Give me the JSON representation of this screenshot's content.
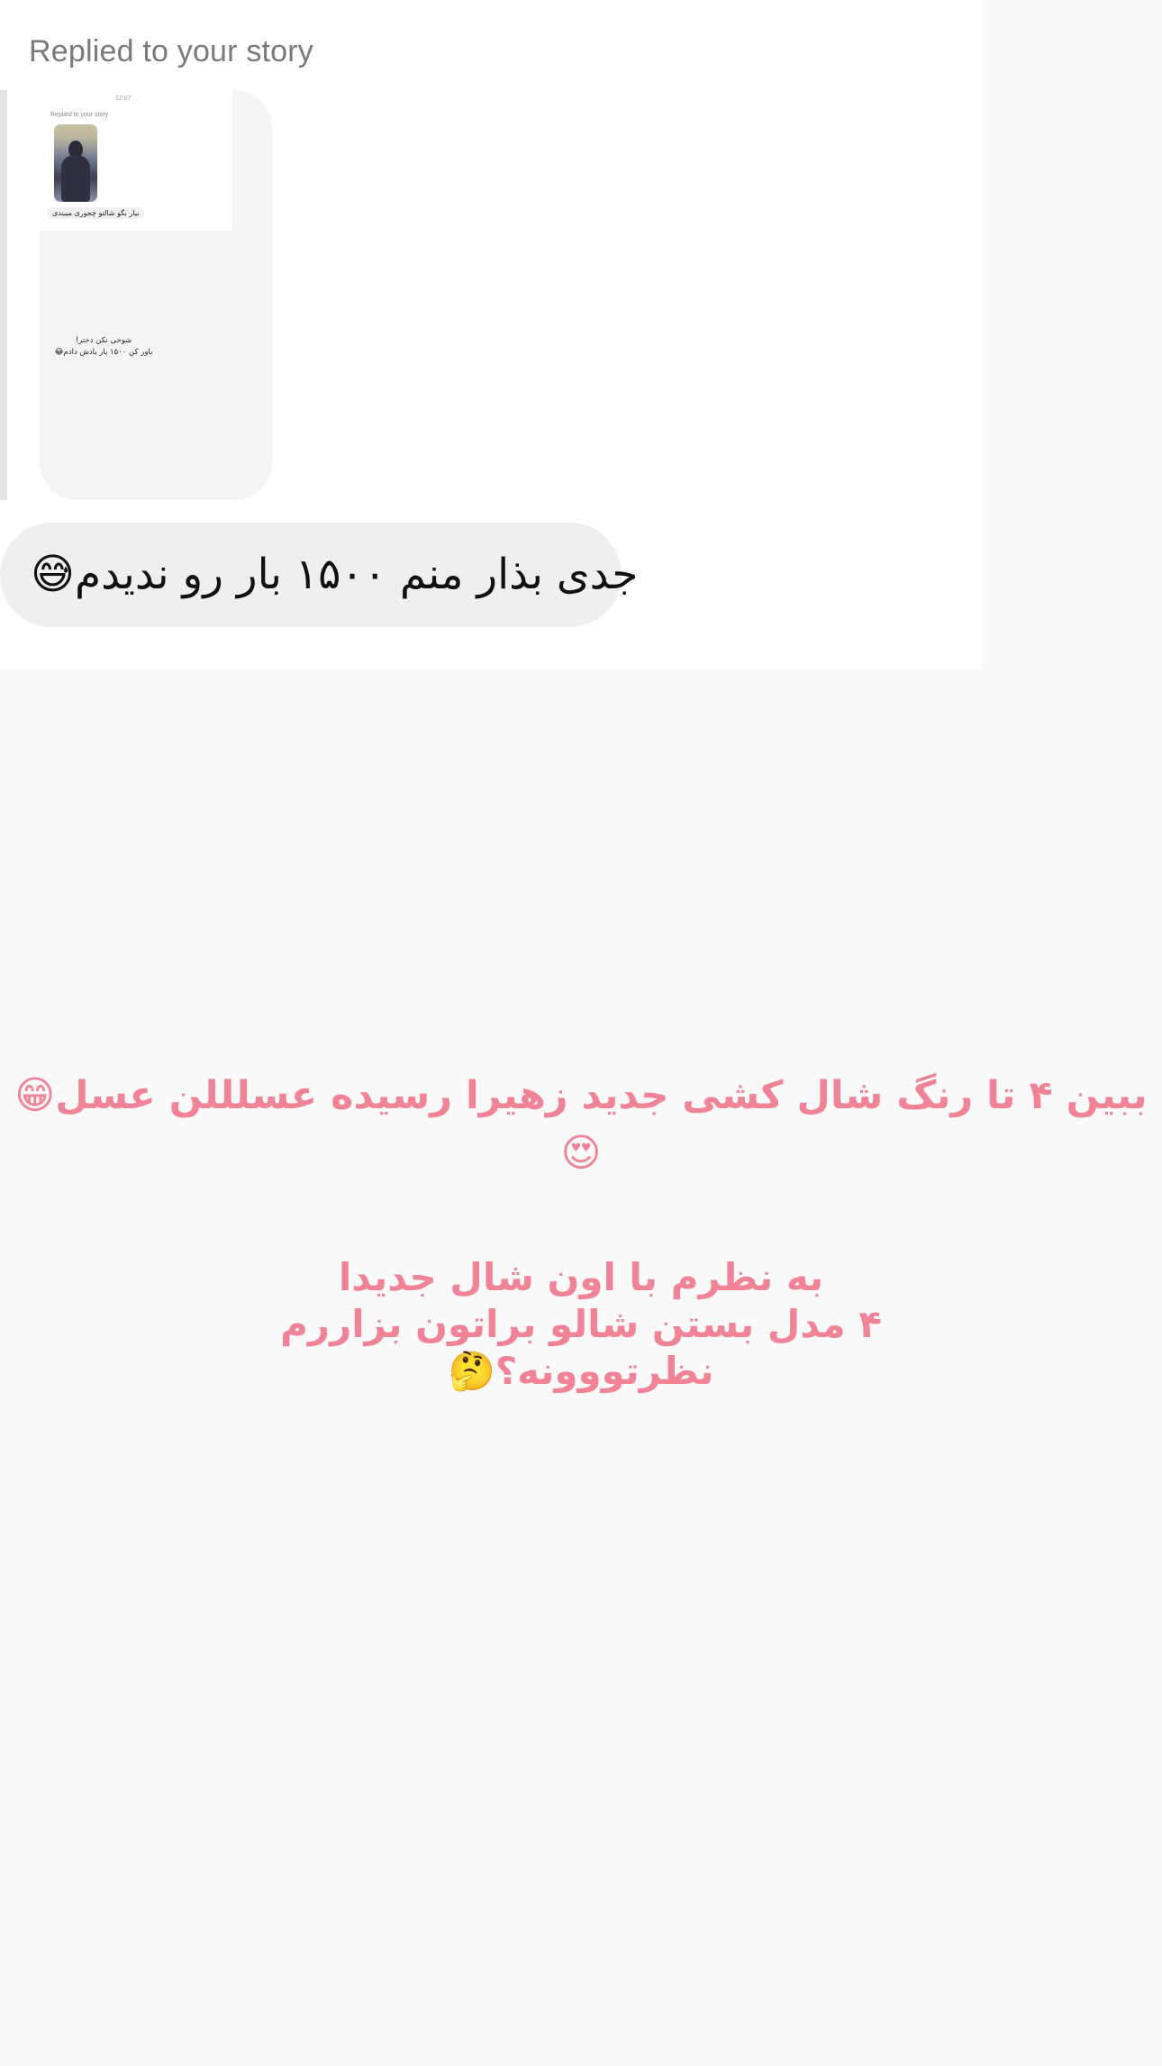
{
  "dm": {
    "replied_label": "Replied to your story",
    "preview": {
      "time": "12:07",
      "replied_label": "Replied to your story",
      "bubble_text": "بیار بگو شالتو چجوری میبندی",
      "reply_line1": "شوخی نکن دختر!",
      "reply_line2": "باور کن ۱۵۰۰ بار یادش دادم😂"
    },
    "reply_text": "جدی بذار منم ۱۵۰۰ بار رو ندیدم😅"
  },
  "story": {
    "caption_line1": "ببین ۴ تا رنگ شال کشی جدید زهیرا رسیده عسلللن عسل😁😍",
    "caption_block": [
      "به نظرم با اون شال جدیدا",
      "۴ مدل بستن شالو براتون بزاررم",
      "نظرتووونه؟🤔"
    ]
  },
  "colors": {
    "caption": "#f08496",
    "bubble": "#efefef",
    "card": "#ffffff",
    "background": "#f9f9f9"
  }
}
